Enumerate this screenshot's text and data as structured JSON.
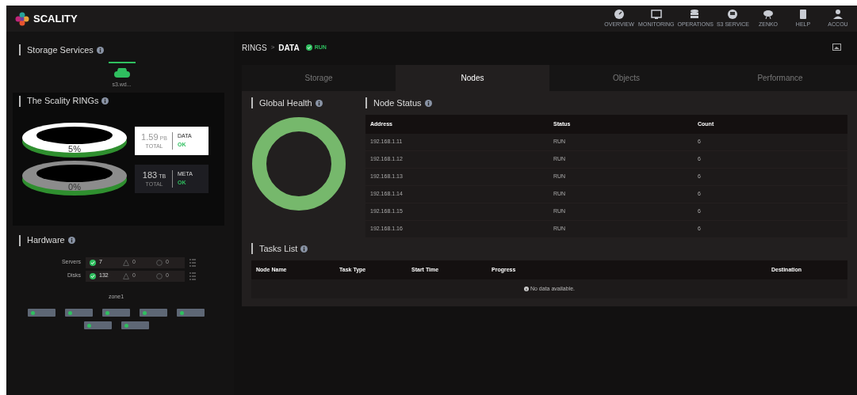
{
  "header": {
    "logo": "SCALITY",
    "nav": [
      {
        "label": "OVERVIEW"
      },
      {
        "label": "MONITORING"
      },
      {
        "label": "OPERATIONS"
      },
      {
        "label": "S3 SERVICE"
      },
      {
        "label": "ZENKO"
      },
      {
        "label": "HELP"
      },
      {
        "label": "ACCOU"
      }
    ]
  },
  "sidebar": {
    "storage_services": {
      "title": "Storage Services",
      "service": {
        "label": "s3.wd...",
        "selected": true
      }
    },
    "rings": {
      "title": "The Scality RINGs",
      "items": [
        {
          "percent": "5%",
          "total": "1.59",
          "unit": "PB",
          "total_label": "TOTAL",
          "name": "DATA",
          "status": "OK",
          "selected": true
        },
        {
          "percent": "0%",
          "total": "183",
          "unit": "TB",
          "total_label": "TOTAL",
          "name": "META",
          "status": "OK",
          "selected": false
        }
      ]
    },
    "hardware": {
      "title": "Hardware",
      "rows": [
        {
          "label": "Servers",
          "ok": "7",
          "warning": "0",
          "error": "0"
        },
        {
          "label": "Disks",
          "ok": "132",
          "warning": "0",
          "error": "0"
        }
      ],
      "zone": "zone1",
      "nodes": [
        {
          "online": true
        },
        {
          "online": true
        },
        {
          "online": true
        },
        {
          "online": true
        },
        {
          "online": true
        },
        {
          "online": true
        },
        {
          "online": true
        }
      ]
    }
  },
  "breadcrumb": {
    "parent": "RINGS",
    "separator": ">",
    "current": "DATA",
    "status": "RUN"
  },
  "tabs": [
    {
      "label": "Storage",
      "selected": false
    },
    {
      "label": "Nodes",
      "selected": true
    },
    {
      "label": "Objects",
      "selected": false
    },
    {
      "label": "Performance",
      "selected": false
    }
  ],
  "global_health": {
    "title": "Global Health"
  },
  "node_status": {
    "title": "Node Status",
    "columns": [
      "Address",
      "Status",
      "Count"
    ],
    "rows": [
      [
        "192.168.1.11",
        "RUN",
        "6"
      ],
      [
        "192.168.1.12",
        "RUN",
        "6"
      ],
      [
        "192.168.1.13",
        "RUN",
        "6"
      ],
      [
        "192.168.1.14",
        "RUN",
        "6"
      ],
      [
        "192.168.1.15",
        "RUN",
        "6"
      ],
      [
        "192.168.1.16",
        "RUN",
        "6"
      ]
    ]
  },
  "tasks_list": {
    "title": "Tasks List",
    "columns": [
      "Node Name",
      "Task Type",
      "Start Time",
      "Progress",
      "Destination"
    ],
    "empty": "No data available."
  }
}
